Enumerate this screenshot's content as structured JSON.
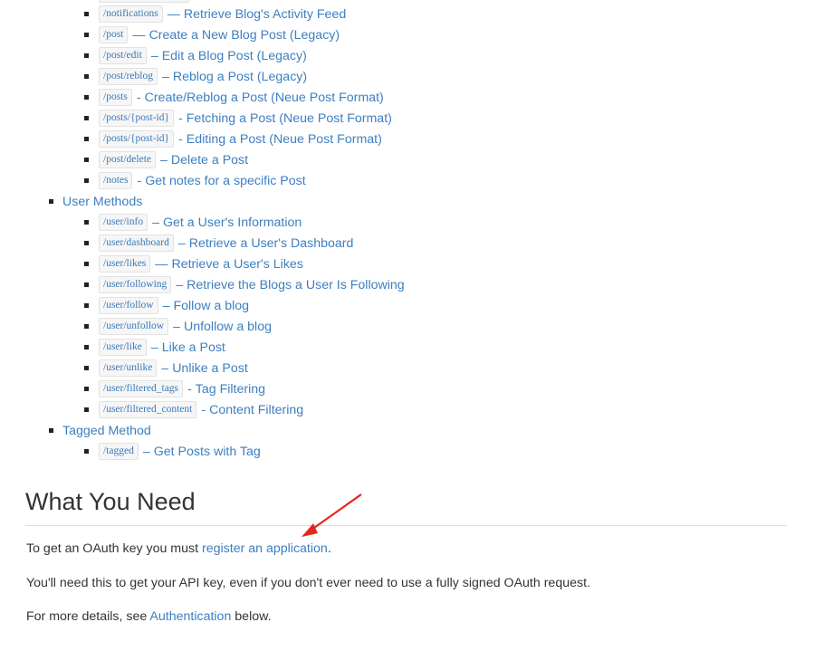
{
  "post_methods": [
    {
      "code": "/notifications",
      "sep": "—",
      "label": "Retrieve Blog's Activity Feed"
    },
    {
      "code": "/post",
      "sep": "—",
      "label": "Create a New Blog Post (Legacy)"
    },
    {
      "code": "/post/edit",
      "sep": "–",
      "label": "Edit a Blog Post (Legacy)"
    },
    {
      "code": "/post/reblog",
      "sep": "–",
      "label": "Reblog a Post (Legacy)"
    },
    {
      "code": "/posts",
      "sep": "-",
      "label": "Create/Reblog a Post (Neue Post Format)"
    },
    {
      "code": "/posts/{post-id}",
      "sep": "-",
      "label": "Fetching a Post (Neue Post Format)"
    },
    {
      "code": "/posts/{post-id}",
      "sep": "-",
      "label": "Editing a Post (Neue Post Format)"
    },
    {
      "code": "/post/delete",
      "sep": "–",
      "label": "Delete a Post"
    },
    {
      "code": "/notes",
      "sep": "-",
      "label": "Get notes for a specific Post"
    }
  ],
  "user_methods": {
    "title": "User Methods",
    "items": [
      {
        "code": "/user/info",
        "sep": "–",
        "label": "Get a User's Information"
      },
      {
        "code": "/user/dashboard",
        "sep": "–",
        "label": "Retrieve a User's Dashboard"
      },
      {
        "code": "/user/likes",
        "sep": "—",
        "label": "Retrieve a User's Likes"
      },
      {
        "code": "/user/following",
        "sep": "–",
        "label": "Retrieve the Blogs a User Is Following"
      },
      {
        "code": "/user/follow",
        "sep": "–",
        "label": "Follow a blog"
      },
      {
        "code": "/user/unfollow",
        "sep": "–",
        "label": "Unfollow a blog"
      },
      {
        "code": "/user/like",
        "sep": "–",
        "label": "Like a Post"
      },
      {
        "code": "/user/unlike",
        "sep": "–",
        "label": "Unlike a Post"
      },
      {
        "code": "/user/filtered_tags",
        "sep": "-",
        "label": "Tag Filtering"
      },
      {
        "code": "/user/filtered_content",
        "sep": "-",
        "label": "Content Filtering"
      }
    ]
  },
  "tagged_method": {
    "title": "Tagged Method",
    "items": [
      {
        "code": "/tagged",
        "sep": "–",
        "label": "Get Posts with Tag"
      }
    ]
  },
  "section": {
    "heading": "What You Need",
    "p1_before": "To get an OAuth key you must ",
    "p1_link": "register an application",
    "p1_after": ".",
    "p2": "You'll need this to get your API key, even if you don't ever need to use a fully signed OAuth request.",
    "p3_before": "For more details, see ",
    "p3_link": "Authentication",
    "p3_after": " below."
  },
  "annotation": {
    "arrow_color": "#e8251f"
  }
}
